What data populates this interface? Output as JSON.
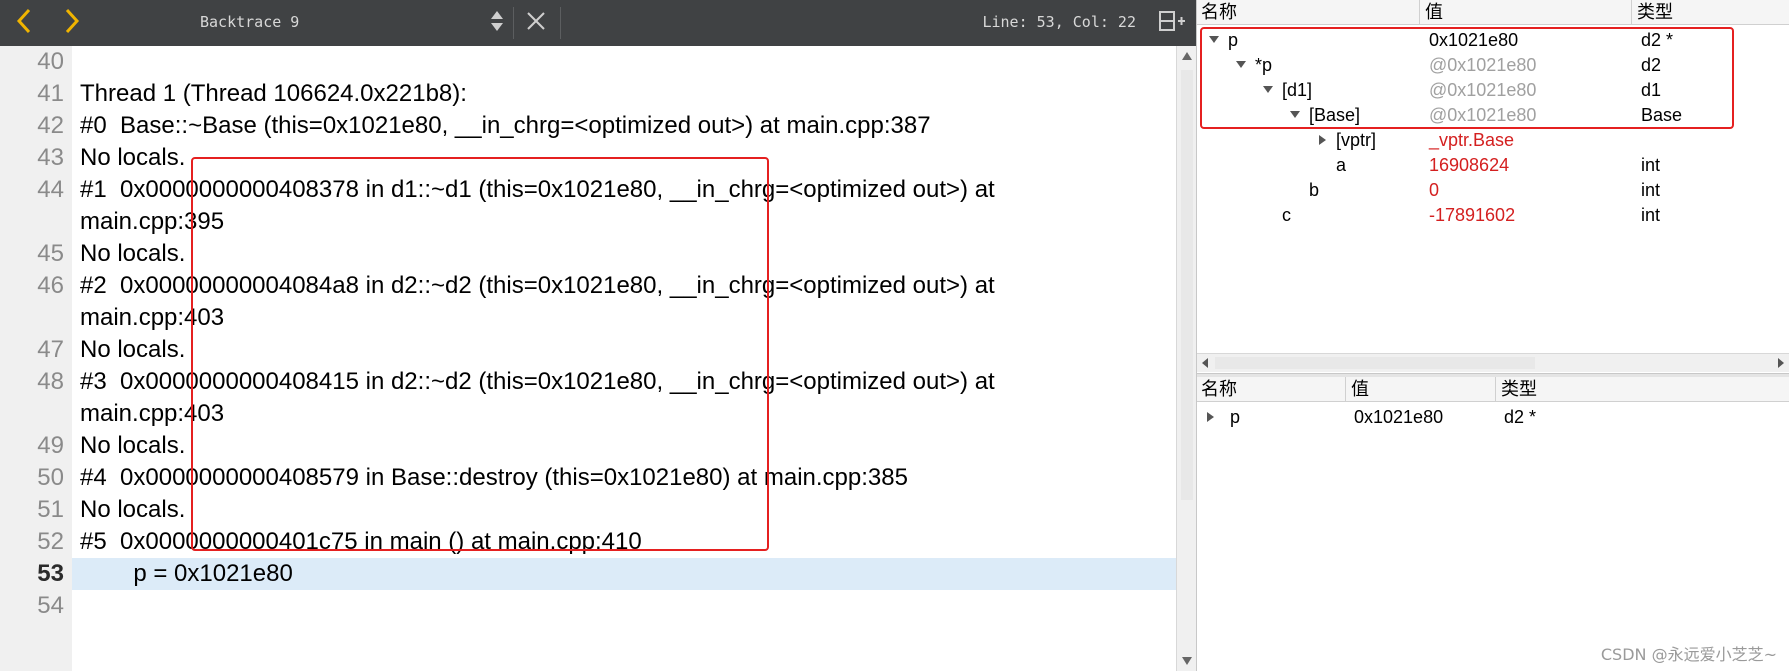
{
  "toolbar": {
    "title": "Backtrace 9",
    "position": "Line: 53, Col: 22",
    "icons": [
      "chevron-left-icon",
      "chevron-right-icon",
      "up-down-icon",
      "close-icon",
      "split-add-icon"
    ],
    "accent": "#f0b400"
  },
  "editor": {
    "lines": [
      {
        "n": "40",
        "text": ""
      },
      {
        "n": "41",
        "text": "Thread 1 (Thread 106624.0x221b8):"
      },
      {
        "n": "42",
        "text": "#0  Base::~Base (this=0x1021e80, __in_chrg=<optimized out>) at main.cpp:387"
      },
      {
        "n": "43",
        "text": "No locals."
      },
      {
        "n": "44",
        "text": "#1  0x0000000000408378 in d1::~d1 (this=0x1021e80, __in_chrg=<optimized out>) at\nmain.cpp:395"
      },
      {
        "n": "45",
        "text": "No locals."
      },
      {
        "n": "46",
        "text": "#2  0x00000000004084a8 in d2::~d2 (this=0x1021e80, __in_chrg=<optimized out>) at\nmain.cpp:403"
      },
      {
        "n": "47",
        "text": "No locals."
      },
      {
        "n": "48",
        "text": "#3  0x0000000000408415 in d2::~d2 (this=0x1021e80, __in_chrg=<optimized out>) at\nmain.cpp:403"
      },
      {
        "n": "49",
        "text": "No locals."
      },
      {
        "n": "50",
        "text": "#4  0x0000000000408579 in Base::destroy (this=0x1021e80) at main.cpp:385"
      },
      {
        "n": "51",
        "text": "No locals."
      },
      {
        "n": "52",
        "text": "#5  0x0000000000401c75 in main () at main.cpp:410"
      },
      {
        "n": "53",
        "text": "        p = 0x1021e80"
      },
      {
        "n": "54",
        "text": ""
      }
    ],
    "current_line": "53"
  },
  "locals": {
    "headers": {
      "name": "名称",
      "value": "值",
      "type": "类型"
    },
    "rows": [
      {
        "name": "p",
        "value": "0x1021e80",
        "type": "d2 *",
        "depth": 0,
        "expander": "down",
        "value_style": "normal"
      },
      {
        "name": "*p",
        "value": "@0x1021e80",
        "type": "d2",
        "depth": 1,
        "expander": "down",
        "value_style": "gray"
      },
      {
        "name": "[d1]",
        "value": "@0x1021e80",
        "type": "d1",
        "depth": 2,
        "expander": "down",
        "value_style": "gray"
      },
      {
        "name": "[Base]",
        "value": "@0x1021e80",
        "type": "Base",
        "depth": 3,
        "expander": "down",
        "value_style": "gray"
      },
      {
        "name": "[vptr]",
        "value": "_vptr.Base",
        "type": "",
        "depth": 4,
        "expander": "right",
        "value_style": "red"
      },
      {
        "name": "a",
        "value": "16908624",
        "type": "int",
        "depth": 4,
        "expander": "none",
        "value_style": "red"
      },
      {
        "name": "b",
        "value": "0",
        "type": "int",
        "depth": 3,
        "expander": "none",
        "value_style": "red"
      },
      {
        "name": "c",
        "value": "-17891602",
        "type": "int",
        "depth": 2,
        "expander": "none",
        "value_style": "red"
      }
    ]
  },
  "watch": {
    "headers": {
      "name": "名称",
      "value": "值",
      "type": "类型"
    },
    "rows": [
      {
        "name": "p",
        "value": "0x1021e80",
        "type": "d2 *",
        "expander": "right"
      }
    ]
  },
  "watermark": "CSDN @永远爱小芝芝~",
  "colors": {
    "highlight_box": "#e52020",
    "changed_value": "#d42020",
    "current_line_bg": "#dcebf8",
    "toolbar_bg": "#404244"
  }
}
